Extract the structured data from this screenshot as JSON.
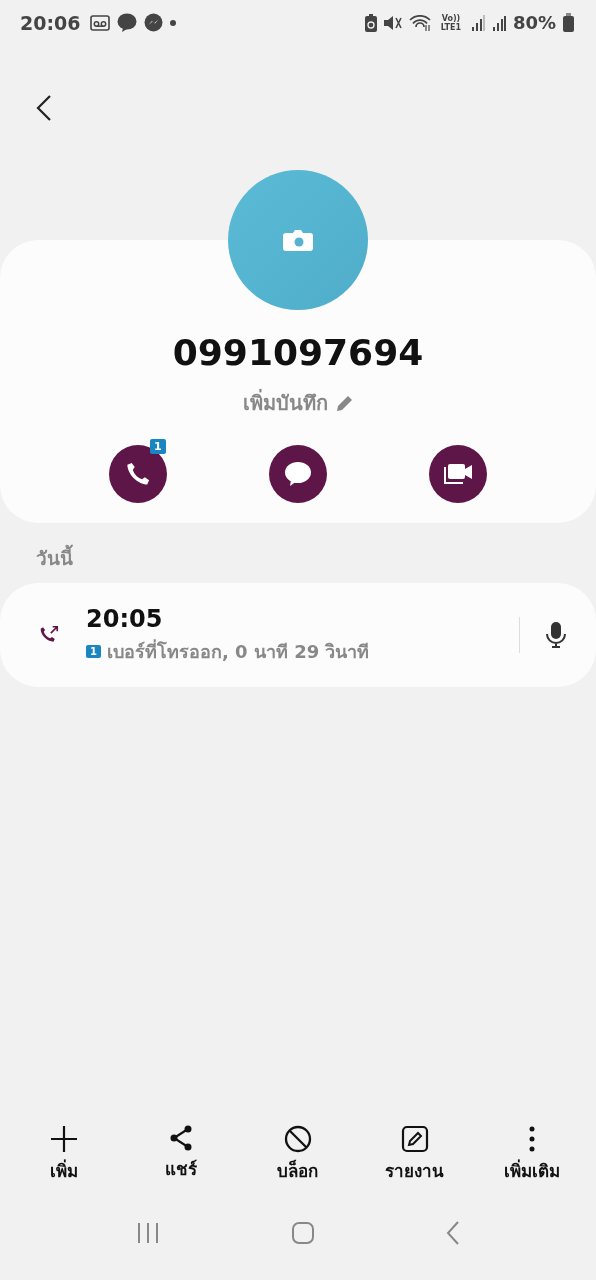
{
  "status_bar": {
    "time": "20:06",
    "network": "Vo)) LTE1",
    "battery": "80%"
  },
  "contact": {
    "number": "0991097694",
    "note_link": "เพิ่มบันทึก"
  },
  "quick_actions": [
    {
      "kind": "call",
      "sim_badge": "1"
    },
    {
      "kind": "message"
    },
    {
      "kind": "video"
    }
  ],
  "history": {
    "heading": "วันนี้",
    "entries": [
      {
        "time": "20:05",
        "sim": "1",
        "detail": "เบอร์ที่โทรออก, 0 นาที 29 วินาที"
      }
    ]
  },
  "bottom_actions": [
    {
      "kind": "add",
      "label": "เพิ่ม"
    },
    {
      "kind": "share",
      "label": "แชร์"
    },
    {
      "kind": "block",
      "label": "บล็อก"
    },
    {
      "kind": "report",
      "label": "รายงาน"
    },
    {
      "kind": "more",
      "label": "เพิ่มเติม"
    }
  ]
}
